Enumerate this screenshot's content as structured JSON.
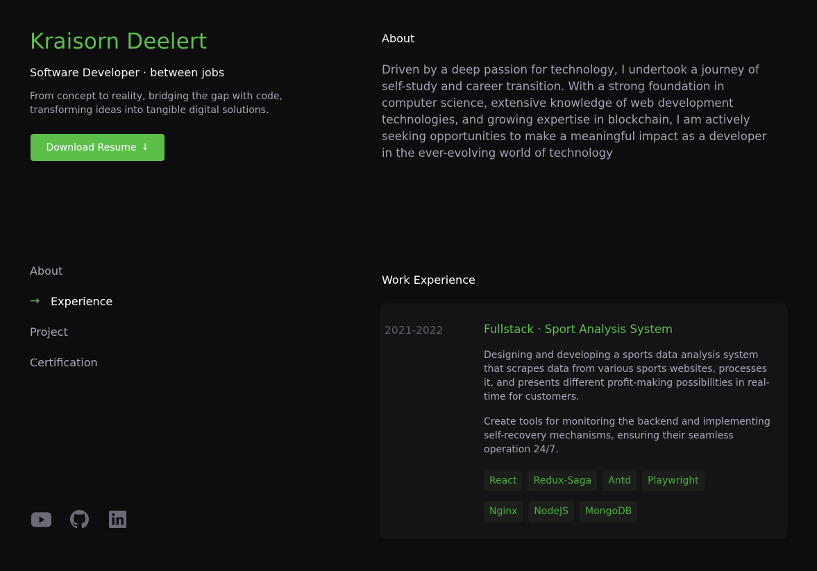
{
  "profile": {
    "name": "Kraisorn Deelert",
    "role": "Software Developer · between jobs",
    "tagline": "From concept to reality, bridging the gap with code, transforming ideas into tangible digital solutions.",
    "resume_button": "Download Resume",
    "resume_icon": "arrow-down-icon"
  },
  "nav": {
    "items": [
      {
        "label": "About",
        "active": false
      },
      {
        "label": "Experience",
        "active": true
      },
      {
        "label": "Project",
        "active": false
      },
      {
        "label": "Certification",
        "active": false
      }
    ],
    "active_icon": "arrow-right-icon"
  },
  "socials": [
    "youtube-icon",
    "github-icon",
    "linkedin-icon"
  ],
  "about": {
    "title": "About",
    "text": "Driven by a deep passion for technology, I undertook a journey of self-study and career transition. With a strong foundation in computer science, extensive knowledge of web development technologies, and growing expertise in blockchain, I am actively seeking opportunities to make a meaningful impact as a developer in the ever-evolving world of technology"
  },
  "work": {
    "title": "Work Experience",
    "items": [
      {
        "period": "2021-2022",
        "title": "Fullstack · Sport Analysis System",
        "descriptions": [
          "Designing and developing a sports data analysis system that scrapes data from various sports websites, processes it, and presents different profit-making possibilities in real-time for customers.",
          "Create tools for monitoring the backend and implementing self-recovery mechanisms, ensuring their seamless operation 24/7."
        ],
        "tags": [
          "React",
          "Redux-Saga",
          "Antd",
          "Playwright",
          "Nginx",
          "NodeJS",
          "MongoDB"
        ]
      }
    ]
  },
  "colors": {
    "background": "#0d0d0e",
    "accent": "#5cbf4a",
    "card": "#141416",
    "tag_bg": "#1c1e1c",
    "muted_text": "#a8a8b8",
    "icon_gray": "#6b6b75"
  }
}
